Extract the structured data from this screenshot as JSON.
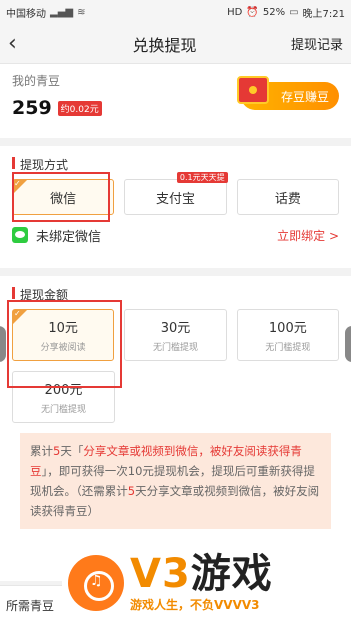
{
  "status": {
    "carrier": "中国移动",
    "network": "HD",
    "battery": "52%",
    "time": "晚上7:21"
  },
  "nav": {
    "title": "兑换提现",
    "record": "提现记录"
  },
  "beans": {
    "label": "我的青豆",
    "amount": "259",
    "rmb": "约0.02元",
    "save_button": "存豆赚豆"
  },
  "method": {
    "title": "提现方式",
    "options": [
      {
        "label": "微信",
        "selected": true
      },
      {
        "label": "支付宝",
        "tag": "0.1元天天提"
      },
      {
        "label": "话费"
      }
    ],
    "bind_status": "未绑定微信",
    "bind_link": "立即绑定 >"
  },
  "amount": {
    "title": "提现金额",
    "options": [
      {
        "value": "10元",
        "desc": "分享被阅读",
        "selected": true
      },
      {
        "value": "30元",
        "desc": "无门槛提现"
      },
      {
        "value": "100元",
        "desc": "无门槛提现"
      },
      {
        "value": "200元",
        "desc": "无门槛提现"
      }
    ]
  },
  "notice": {
    "p1": "累计",
    "n1": "5",
    "p2": "天「",
    "h1": "分享文章或视频到微信，被好友阅读获得青豆",
    "p3": "」，即可获得一次10元提现机会，提现后可重新获得提现机会。（还需累计",
    "n2": "5",
    "p4": "天分享文章或视频到微信，被好友阅读获得青豆）"
  },
  "footer": {
    "label": "所需青豆"
  },
  "watermark": {
    "big_v3": "V3",
    "big_game": "游戏",
    "slogan": "游戏人生，不负VVVV3"
  },
  "colors": {
    "accent_red": "#e53935",
    "selected_border": "#f0a040",
    "notice_bg": "#fde8dc",
    "brand_orange": "#f28b00"
  }
}
